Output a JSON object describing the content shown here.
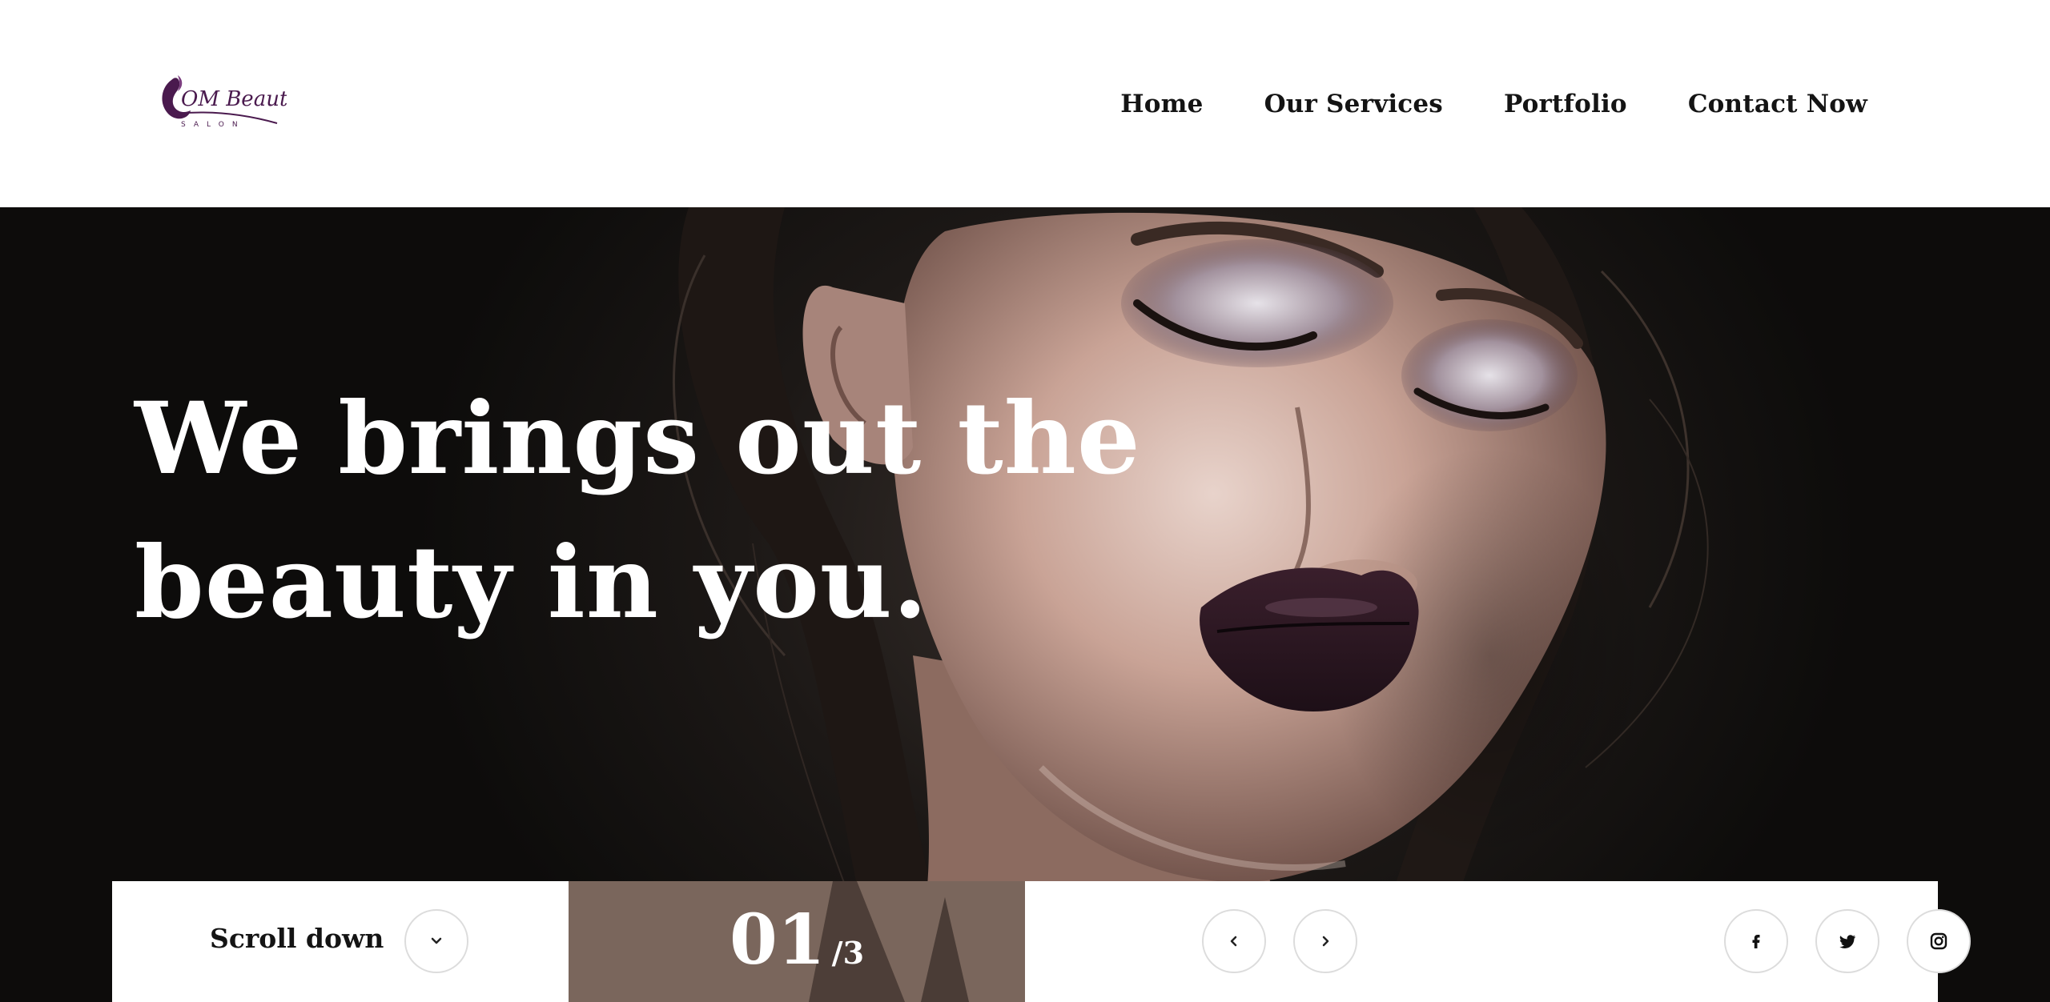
{
  "header": {
    "logo": {
      "text": "OM Beauty",
      "subtitle": "SALON",
      "icon": "om-salon-logo"
    },
    "nav": [
      {
        "label": "Home"
      },
      {
        "label": "Our Services"
      },
      {
        "label": "Portfolio"
      },
      {
        "label": "Contact Now"
      }
    ]
  },
  "hero": {
    "headline_line1": "We brings out the",
    "headline_line2": "beauty in you.",
    "image": "portrait-woman-dark-lipstick"
  },
  "slider": {
    "scroll_label": "Scroll down",
    "scroll_icon": "chevron-down-icon",
    "current": "01",
    "separator": "/",
    "total": "3",
    "prev_icon": "chevron-left-icon",
    "next_icon": "chevron-right-icon"
  },
  "social": [
    {
      "name": "facebook-icon"
    },
    {
      "name": "twitter-icon"
    },
    {
      "name": "instagram-icon"
    }
  ],
  "colors": {
    "logo_purple": "#4a1a4e",
    "nav_text": "#141414",
    "hero_text": "#ffffff",
    "counter_bg": "#7a665c",
    "button_border": "#dcdcdc"
  }
}
